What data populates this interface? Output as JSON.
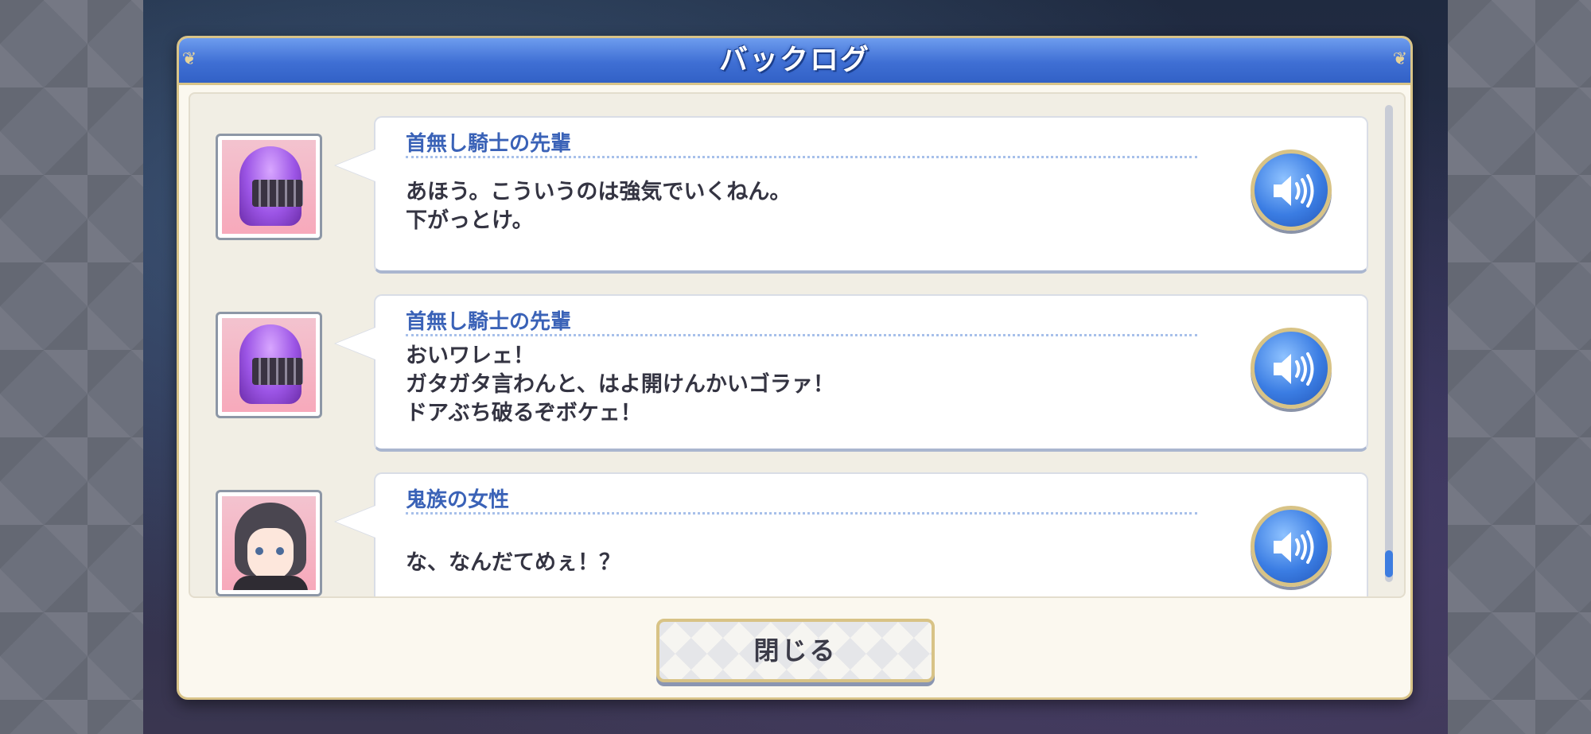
{
  "dialog": {
    "title": "バックログ",
    "close_label": "閉じる"
  },
  "entries": [
    {
      "speaker": "首無し騎士の先輩",
      "text": "あほう。こういうのは強気でいくねん。\n下がっとけ。",
      "portrait": "headless-knight",
      "voice_icon": "speaker-icon"
    },
    {
      "speaker": "首無し騎士の先輩",
      "text": "おいワレェ！\nガタガタ言わんと、はよ開けんかいゴラァ！\nドアぶち破るぞボケェ！",
      "portrait": "headless-knight",
      "voice_icon": "speaker-icon"
    },
    {
      "speaker": "鬼族の女性",
      "text": "な、なんだてめぇ！？",
      "portrait": "oni-woman",
      "voice_icon": "speaker-icon"
    }
  ],
  "colors": {
    "title_bar": "#3f6fd4",
    "speaker_name": "#3a62b7",
    "frame_gold": "#d9c488",
    "voice_button": "#3b7de3"
  }
}
